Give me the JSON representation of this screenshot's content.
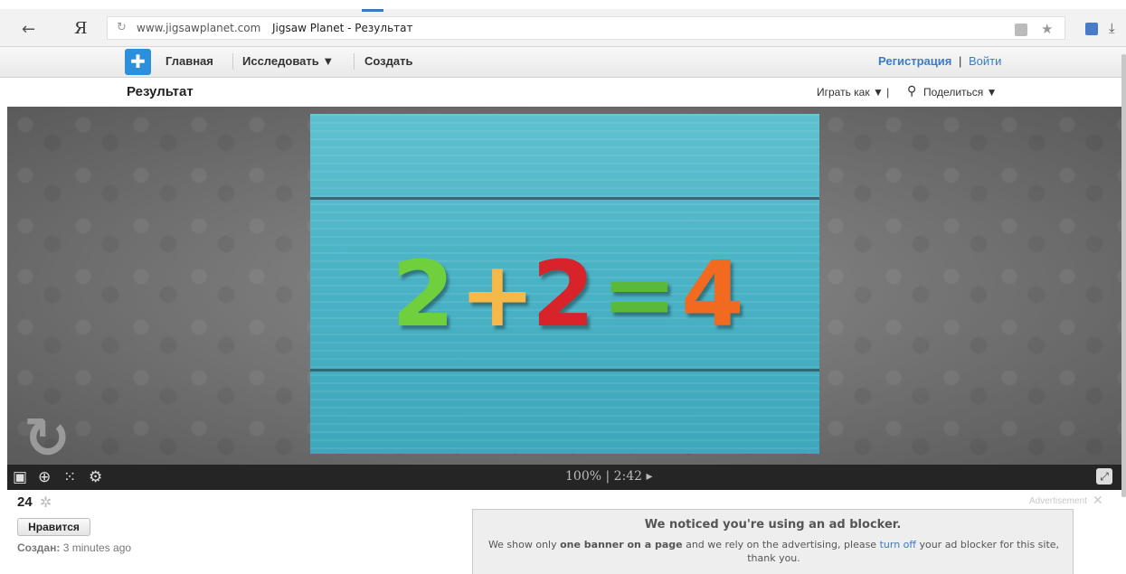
{
  "browser": {
    "url": "www.jigsawplanet.com",
    "page_title": "Jigsaw Planet - Результат",
    "logo_text": "Я"
  },
  "nav": {
    "home": "Главная",
    "explore": "Исследовать ▼",
    "create": "Создать",
    "register": "Регистрация",
    "separator": "|",
    "login": "Войти"
  },
  "header": {
    "title": "Результат",
    "play_as": "Играть как ▼ |",
    "share": "Поделиться ▼"
  },
  "puzzle": {
    "equation": [
      {
        "char": "2",
        "color": "#6fcf3c"
      },
      {
        "char": "+",
        "color": "#f7b84a"
      },
      {
        "char": "2",
        "color": "#d8232a"
      },
      {
        "char": "=",
        "color": "#5ab83a"
      },
      {
        "char": "4",
        "color": "#f26a1f"
      }
    ],
    "progress": "100% | 2:42 ▸"
  },
  "info": {
    "pieces": "24",
    "like_label": "Нравится",
    "created_label": "Создан:",
    "created_value": "3 minutes ago"
  },
  "ad": {
    "label": "Advertisement",
    "title": "We noticed you're using an ad blocker.",
    "text_1": "We show only ",
    "text_bold": "one banner on a page",
    "text_2": " and we rely on the advertising, please ",
    "text_link": "turn off",
    "text_3": " your ad blocker for this site, thank you."
  }
}
